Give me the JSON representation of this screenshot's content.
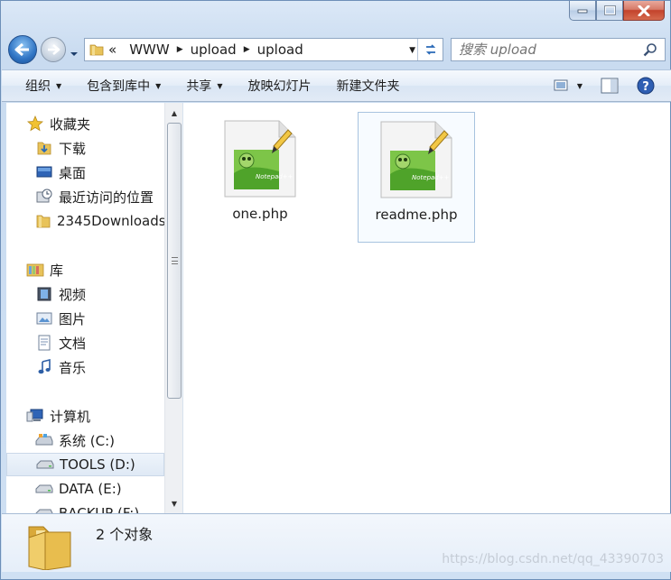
{
  "address": {
    "overflow": "«",
    "segments": [
      "WWW",
      "upload",
      "upload"
    ]
  },
  "search": {
    "placeholder": "搜索 upload"
  },
  "commands": {
    "organize": "组织",
    "include_library": "包含到库中",
    "share": "共享",
    "slideshow": "放映幻灯片",
    "new_folder": "新建文件夹"
  },
  "nav": {
    "favorites": "收藏夹",
    "downloads": "下载",
    "desktop": "桌面",
    "recent": "最近访问的位置",
    "downloads2345": "2345Downloads",
    "libraries": "库",
    "videos": "视频",
    "pictures": "图片",
    "documents": "文档",
    "music": "音乐",
    "computer": "计算机",
    "drive_c": "系统 (C:)",
    "drive_d": "TOOLS (D:)",
    "drive_e": "DATA (E:)",
    "drive_f": "BACKUP (F:)"
  },
  "files": [
    {
      "name": "one.php"
    },
    {
      "name": "readme.php"
    }
  ],
  "details": {
    "count_text": "2 个对象"
  },
  "watermark": "https://blog.csdn.net/qq_43390703",
  "colors": {
    "accent": "#2f74c4",
    "selection": "#a8c3df"
  }
}
